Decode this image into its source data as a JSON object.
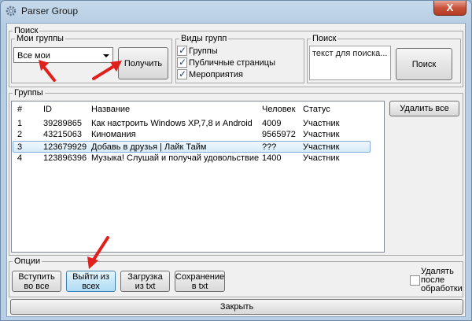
{
  "window": {
    "title": "Parser Group",
    "close_label": "X"
  },
  "search_section": {
    "label": "Поиск",
    "my_groups": {
      "label": "Мои группы",
      "selected": "Все мои",
      "get_button": "Получить"
    },
    "group_types": {
      "label": "Виды групп",
      "options": [
        {
          "label": "Группы",
          "checked": true
        },
        {
          "label": "Публичные страницы",
          "checked": true
        },
        {
          "label": "Мероприятия",
          "checked": true
        }
      ]
    },
    "search": {
      "label": "Поиск",
      "value": "текст для поиска...",
      "button": "Поиск"
    }
  },
  "groups_section": {
    "label": "Группы",
    "delete_all_button": "Удалить все",
    "columns": [
      "#",
      "ID",
      "Название",
      "Человек",
      "Статус"
    ],
    "rows": [
      {
        "num": "1",
        "id": "39289865",
        "name": "Как настроить Windows XP,7,8 и Android",
        "people": "4009",
        "status": "Участник"
      },
      {
        "num": "2",
        "id": "43215063",
        "name": "Киномания",
        "people": "9565972",
        "status": "Участник"
      },
      {
        "num": "3",
        "id": "123679929",
        "name": "Добавь в друзья | Лайк Тайм",
        "people": "???",
        "status": "Участник"
      },
      {
        "num": "4",
        "id": "123896396",
        "name": "Музыка! Слушай и получай удовольствие",
        "people": "1400",
        "status": "Участник"
      }
    ],
    "selected_row": 3
  },
  "options_section": {
    "label": "Опции",
    "join_all": "Вступить во все",
    "leave_all": "Выйти из всех",
    "load_txt": "Загрузка из txt",
    "save_txt": "Сохранение в txt",
    "delete_after": {
      "label": "Удалять после обработки",
      "checked": false
    }
  },
  "close_button": "Закрыть",
  "colors": {
    "annotation_arrow": "#e0201b",
    "selection_border": "#84acdd"
  }
}
